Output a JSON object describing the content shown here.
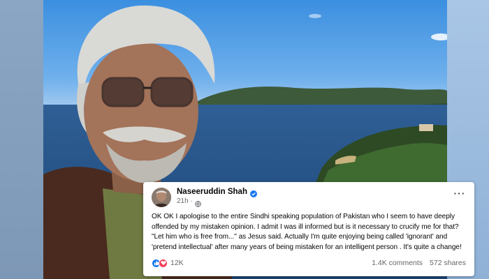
{
  "post": {
    "author": "Naseeruddin Shah",
    "time": "21h",
    "separator": "·",
    "text": "OK OK I apologise to the entire Sindhi speaking population of Pakistan who I seem to have deeply offended by my mistaken opinion. I admit I was ill informed  but is it necessary to crucify me for that? \"Let him who is free from...\" as Jesus said. Actually I'm quite enjoying being called 'ignorant' and 'pretend intellectual' after many years of being mistaken for an intelligent person . It's quite a change!",
    "more_label": "···",
    "reaction_count": "12K",
    "comments": "1.4K comments",
    "shares": "572 shares",
    "reactions": [
      "like-icon",
      "love-icon"
    ]
  },
  "colors": {
    "verified": "#1877f2",
    "like": "#1877f2",
    "love": "#f33e58",
    "secondary_text": "#65676b"
  }
}
